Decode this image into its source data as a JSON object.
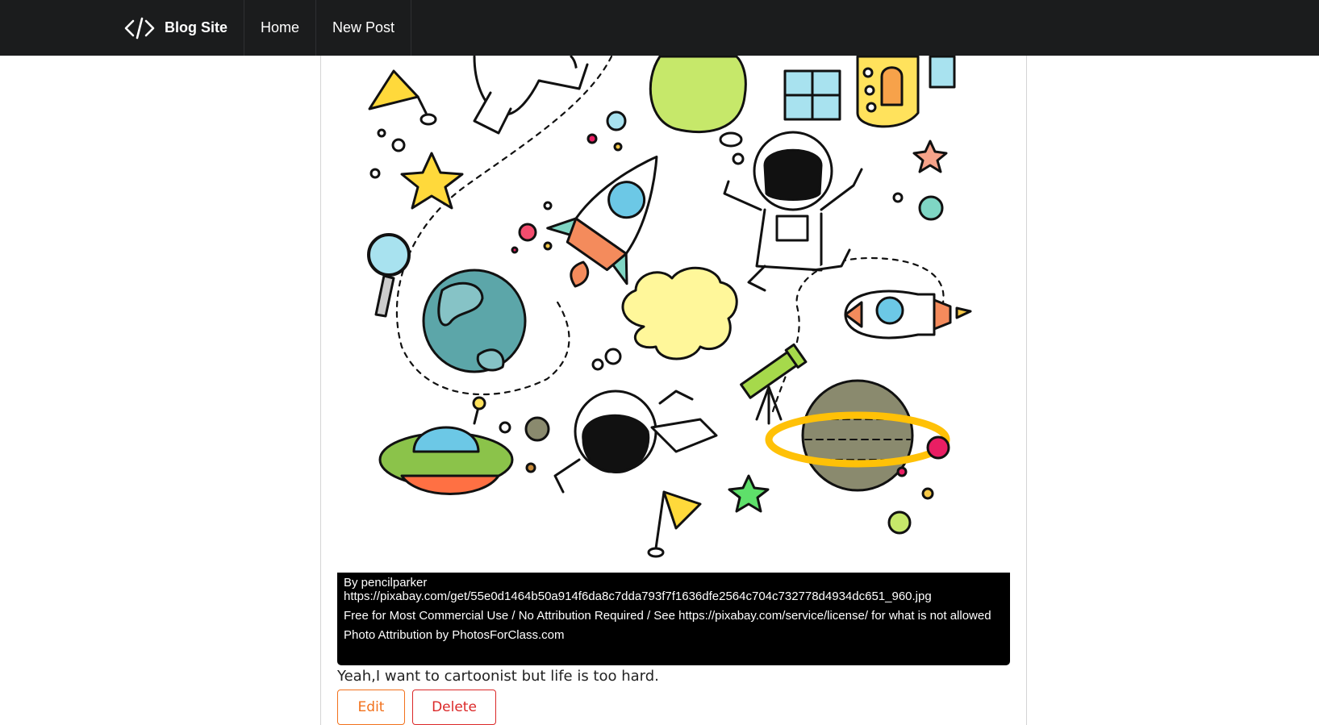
{
  "nav": {
    "brand": "Blog Site",
    "brand_icon": "code-icon",
    "items": [
      {
        "label": "Home"
      },
      {
        "label": "New Post"
      }
    ]
  },
  "post": {
    "image_alt": "cartoon space doodles",
    "attribution": {
      "author": "By pencilparker",
      "url": "https://pixabay.com/get/55e0d1464b50a914f6da8c7dda793f7f1636dfe2564c704c732778d4934dc651_960.jpg",
      "license": "Free for Most Commercial Use / No Attribution Required / See https://pixabay.com/service/license/ for what is not allowed",
      "credit": "Photo Attribution by PhotosForClass.com"
    },
    "body": "Yeah,I want to cartoonist but life is too hard.",
    "edit_label": "Edit",
    "delete_label": "Delete"
  },
  "colors": {
    "navbar_bg": "#1b1c1d",
    "edit": "#f2711c",
    "delete": "#db2828"
  }
}
